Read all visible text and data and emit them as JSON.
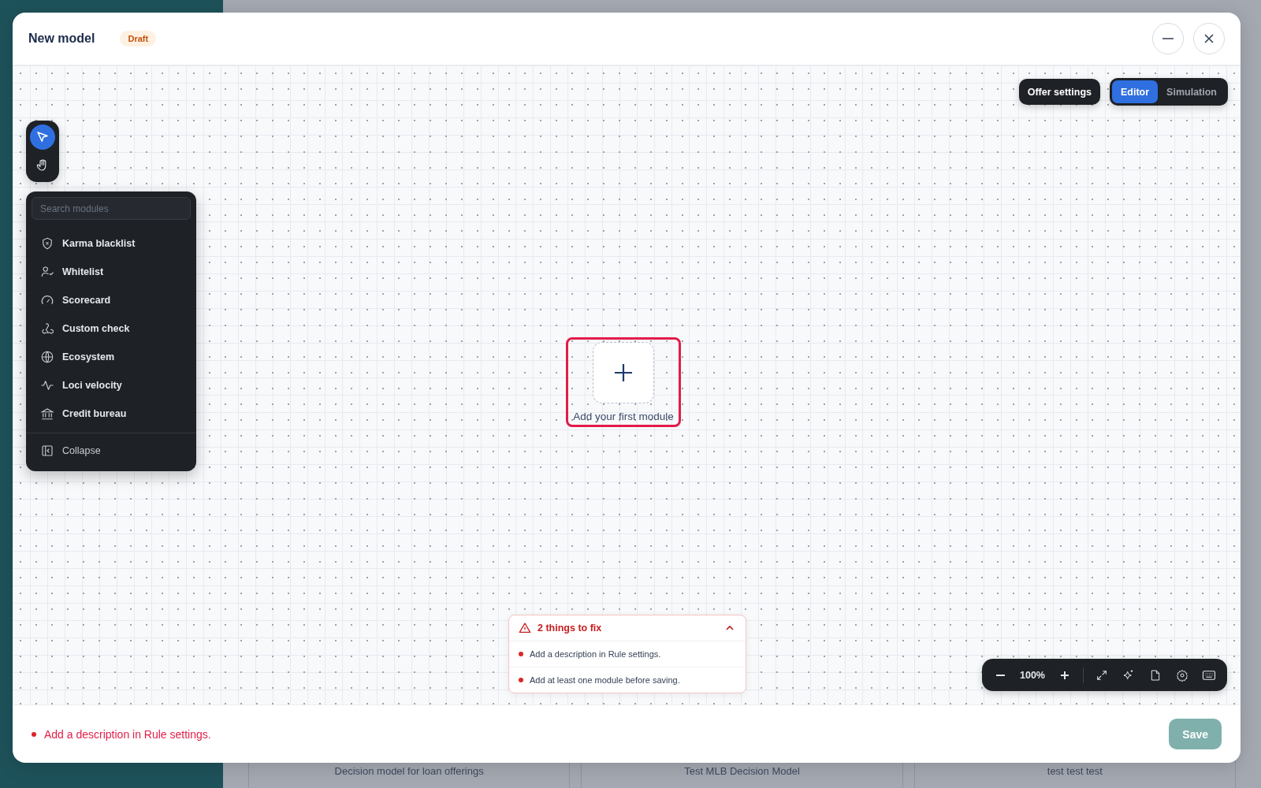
{
  "window": {
    "title": "New model",
    "badge": "Draft"
  },
  "view_switch": {
    "offer_settings": "Offer settings",
    "tabs": [
      {
        "label": "Editor",
        "selected": true
      },
      {
        "label": "Simulation",
        "selected": false
      }
    ]
  },
  "tools": [
    {
      "kind": "pointer",
      "selected": true
    },
    {
      "kind": "hand",
      "selected": false
    }
  ],
  "module_menu": {
    "search": {
      "placeholder": "Search modules"
    },
    "items": [
      {
        "label": "Karma blacklist",
        "kind": "shield"
      },
      {
        "label": "Whitelist",
        "kind": "user"
      },
      {
        "label": "Scorecard",
        "kind": "gauge"
      },
      {
        "label": "Custom check",
        "kind": "webhook"
      },
      {
        "label": "Ecosystem",
        "kind": "globe"
      },
      {
        "label": "Loci velocity",
        "kind": "pulse"
      },
      {
        "label": "Credit bureau",
        "kind": "bank"
      }
    ],
    "collapse": "Collapse"
  },
  "canvas": {
    "empty_label": "Add your first module"
  },
  "issues": {
    "title": "2 things to fix",
    "expanded": true,
    "items": [
      "Add a description in Rule settings.",
      "Add at least one module before saving."
    ]
  },
  "zoom_bar": {
    "zoom_label": "100%"
  },
  "footer": {
    "error": "Add a description in Rule settings.",
    "save": "Save"
  },
  "background_cards": [
    "Decision model for loan offerings",
    "Test MLB Decision Model",
    "test test test"
  ]
}
